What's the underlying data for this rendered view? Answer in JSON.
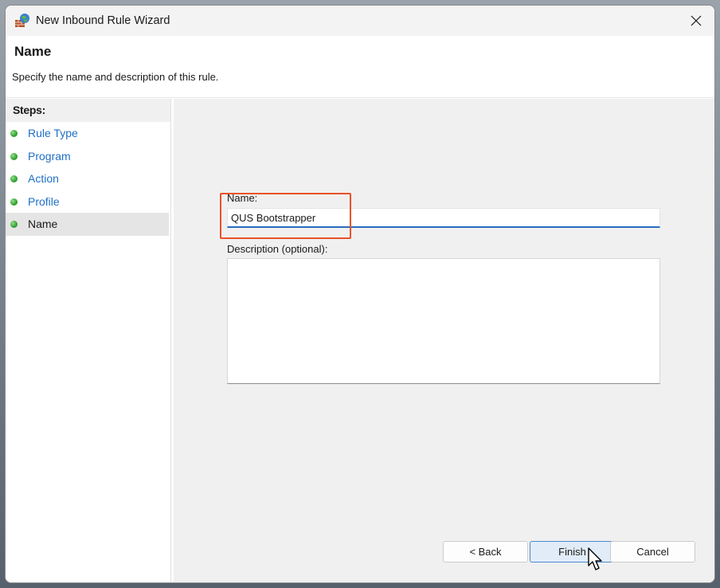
{
  "window": {
    "title": "New Inbound Rule Wizard"
  },
  "header": {
    "title": "Name",
    "description": "Specify the name and description of this rule."
  },
  "steps": {
    "heading": "Steps:",
    "items": [
      {
        "label": "Rule Type"
      },
      {
        "label": "Program"
      },
      {
        "label": "Action"
      },
      {
        "label": "Profile"
      },
      {
        "label": "Name"
      }
    ],
    "active_index": 4
  },
  "form": {
    "name_label": "Name:",
    "name_value": "QUS Bootstrapper",
    "description_label": "Description (optional):",
    "description_value": ""
  },
  "buttons": {
    "back": "< Back",
    "finish": "Finish",
    "cancel": "Cancel"
  },
  "colors": {
    "accent": "#2a6cbf",
    "link": "#1f6fc5",
    "highlight": "#e8532a",
    "step_dot": "#3aa537"
  },
  "icons": {
    "app": "firewall-icon",
    "close": "close-icon",
    "step": "green-dot-icon",
    "cursor": "mouse-pointer-icon"
  }
}
